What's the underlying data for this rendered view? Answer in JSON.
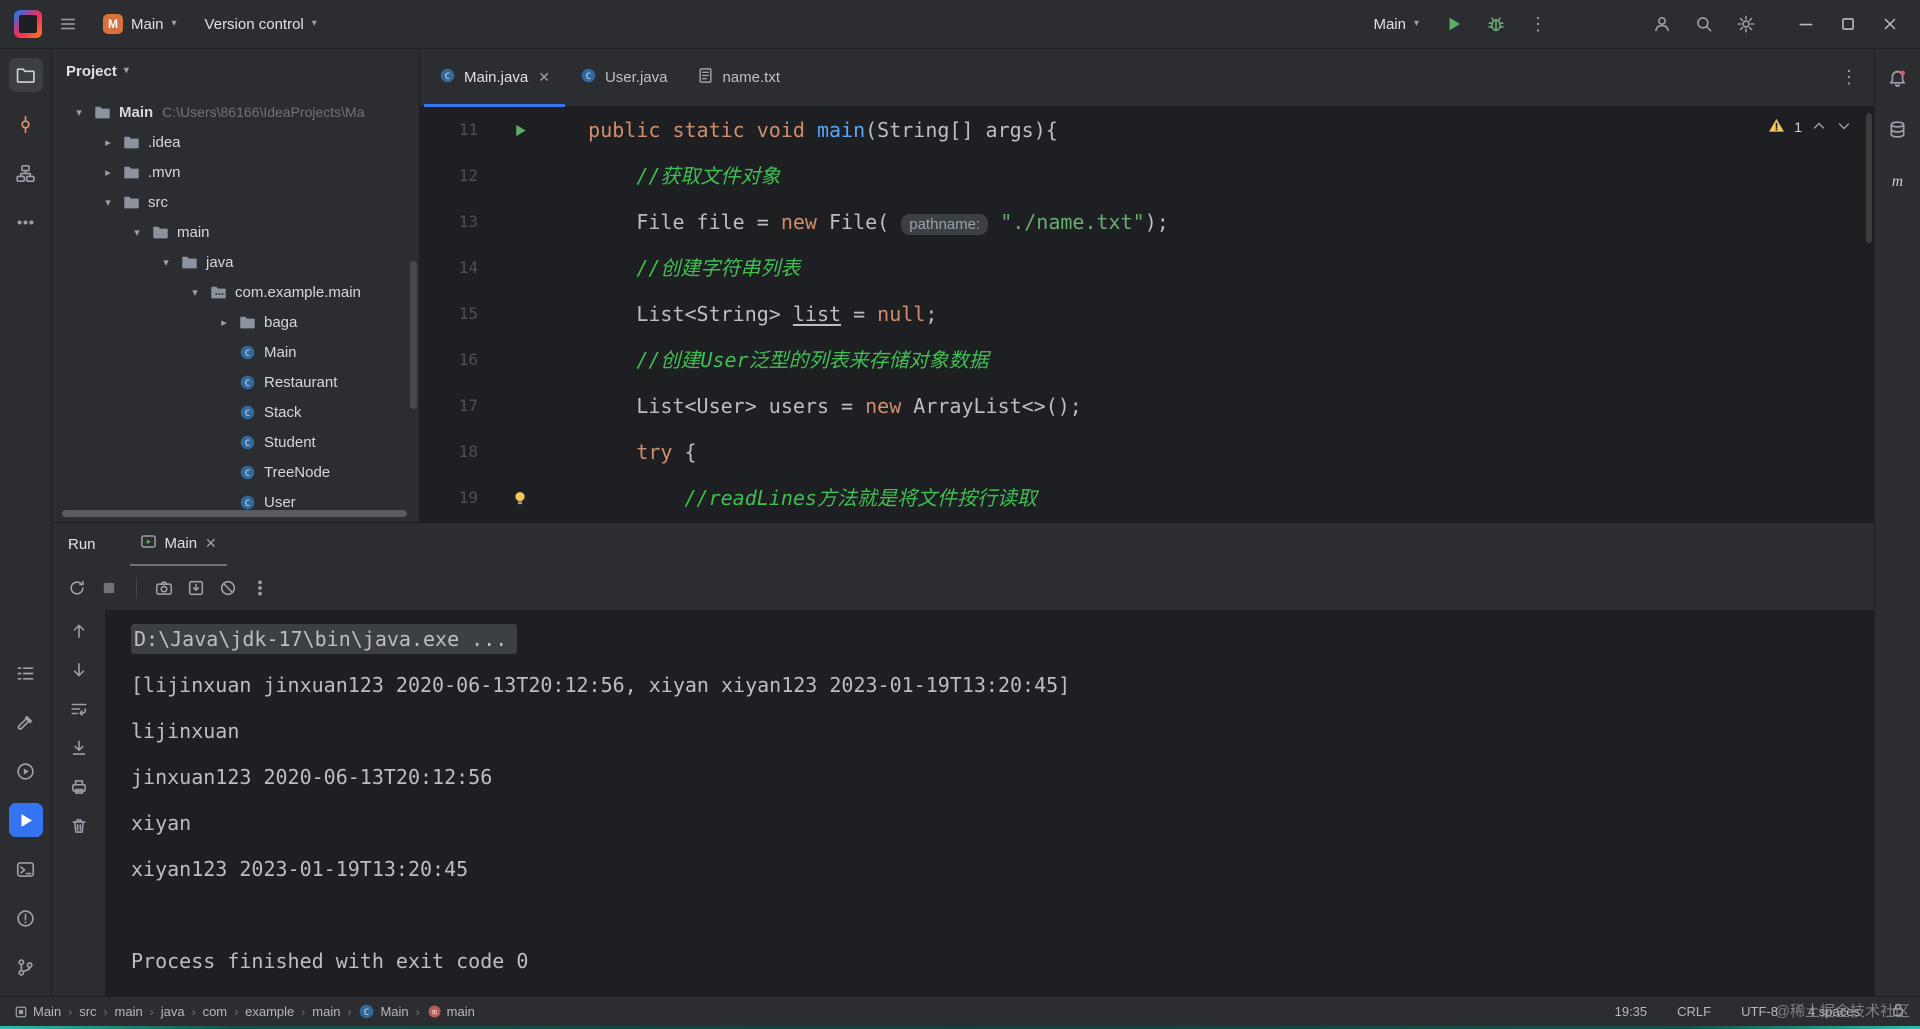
{
  "colors": {
    "accent": "#3574f0",
    "run_green": "#5fad65",
    "keyword": "#cf8e6d",
    "string": "#6aab73",
    "comment": "#3fbf52",
    "method": "#56a8f5",
    "warning": "#f2c55c",
    "editor_bg": "#1e1f22",
    "panel_bg": "#2b2d30"
  },
  "titlebar": {
    "project_initial": "M",
    "project_name": "Main",
    "vcs_label": "Version control",
    "run_config": "Main"
  },
  "left_strip": {
    "top": [
      {
        "name": "project-folder-icon",
        "active": true
      },
      {
        "name": "commit-icon",
        "active": false
      },
      {
        "name": "structure-icon",
        "active": false
      },
      {
        "name": "more-tools-icon",
        "active": false
      }
    ],
    "bottom": [
      {
        "name": "todo-icon",
        "active": false
      },
      {
        "name": "build-icon",
        "active": false
      },
      {
        "name": "services-icon",
        "active": false
      },
      {
        "name": "run-tool-icon",
        "active": true
      },
      {
        "name": "terminal-icon",
        "active": false
      },
      {
        "name": "problems-icon",
        "active": false
      },
      {
        "name": "git-branch-icon",
        "active": false
      }
    ]
  },
  "right_strip": [
    "notifications-icon",
    "database-icon",
    "maven-icon"
  ],
  "project_panel": {
    "title": "Project",
    "tree": [
      {
        "label": "Main",
        "path": "C:\\Users\\86166\\IdeaProjects\\Ma",
        "level": 0,
        "chevron": "expanded",
        "icon": "folder",
        "bold": true
      },
      {
        "label": ".idea",
        "level": 1,
        "chevron": "collapsed",
        "icon": "folder"
      },
      {
        "label": ".mvn",
        "level": 1,
        "chevron": "collapsed",
        "icon": "folder"
      },
      {
        "label": "src",
        "level": 1,
        "chevron": "expanded",
        "icon": "folder"
      },
      {
        "label": "main",
        "level": 2,
        "chevron": "expanded",
        "icon": "folder"
      },
      {
        "label": "java",
        "level": 3,
        "chevron": "expanded",
        "icon": "folder"
      },
      {
        "label": "com.example.main",
        "level": 4,
        "chevron": "expanded",
        "icon": "package"
      },
      {
        "label": "baga",
        "level": 5,
        "chevron": "collapsed",
        "icon": "folder"
      },
      {
        "label": "Main",
        "level": 5,
        "chevron": "none",
        "icon": "class"
      },
      {
        "label": "Restaurant",
        "level": 5,
        "chevron": "none",
        "icon": "class"
      },
      {
        "label": "Stack",
        "level": 5,
        "chevron": "none",
        "icon": "class"
      },
      {
        "label": "Student",
        "level": 5,
        "chevron": "none",
        "icon": "class"
      },
      {
        "label": "TreeNode",
        "level": 5,
        "chevron": "none",
        "icon": "class"
      },
      {
        "label": "User",
        "level": 5,
        "chevron": "none",
        "icon": "class"
      }
    ]
  },
  "editor": {
    "tabs": [
      {
        "label": "Main.java",
        "icon": "class",
        "active": true,
        "closable": true
      },
      {
        "label": "User.java",
        "icon": "class",
        "active": false,
        "closable": false
      },
      {
        "label": "name.txt",
        "icon": "textfile",
        "active": false,
        "closable": false
      }
    ],
    "inspections": {
      "warnings": "1"
    },
    "lines": [
      {
        "num": "11",
        "gutter": "run",
        "tokens": [
          {
            "t": "    "
          },
          {
            "t": "public static void ",
            "s": "kw"
          },
          {
            "t": "main",
            "s": "method"
          },
          {
            "t": "(String[] args){"
          }
        ]
      },
      {
        "num": "12",
        "tokens": [
          {
            "t": "        "
          },
          {
            "t": "//获取文件对象",
            "s": "comment"
          }
        ]
      },
      {
        "num": "13",
        "tokens": [
          {
            "t": "        "
          },
          {
            "t": "File file = "
          },
          {
            "t": "new",
            "s": "kw"
          },
          {
            "t": " File( "
          },
          {
            "t": "pathname:",
            "s": "hint"
          },
          {
            "t": " "
          },
          {
            "t": "\"./name.txt\"",
            "s": "str"
          },
          {
            "t": ");"
          }
        ]
      },
      {
        "num": "14",
        "tokens": [
          {
            "t": "        "
          },
          {
            "t": "//创建字符串列表",
            "s": "comment"
          }
        ]
      },
      {
        "num": "15",
        "tokens": [
          {
            "t": "        "
          },
          {
            "t": "List<String> "
          },
          {
            "t": "list",
            "s": "var"
          },
          {
            "t": " = "
          },
          {
            "t": "null",
            "s": "kw"
          },
          {
            "t": ";"
          }
        ]
      },
      {
        "num": "16",
        "tokens": [
          {
            "t": "        "
          },
          {
            "t": "//创建User泛型的列表来存储对象数据",
            "s": "comment"
          }
        ]
      },
      {
        "num": "17",
        "tokens": [
          {
            "t": "        "
          },
          {
            "t": "List<User> users = "
          },
          {
            "t": "new",
            "s": "kw"
          },
          {
            "t": " ArrayList<>();"
          }
        ]
      },
      {
        "num": "18",
        "tokens": [
          {
            "t": "        "
          },
          {
            "t": "try",
            "s": "kw"
          },
          {
            "t": " {"
          }
        ]
      },
      {
        "num": "19",
        "gutter": "bulb",
        "tokens": [
          {
            "t": "            "
          },
          {
            "t": "//readLines方法就是将文件按行读取",
            "s": "comment"
          }
        ]
      }
    ]
  },
  "run_panel": {
    "title": "Run",
    "tab": "Main",
    "toolbar": [
      "rerun-icon",
      "stop-icon",
      "separator",
      "camera-icon",
      "import-icon",
      "mute-icon",
      "more-options-icon"
    ],
    "gutter_icons": [
      "arrow-up-icon",
      "arrow-down-icon",
      "softwrap-icon",
      "scroll-end-icon",
      "print-icon",
      "clear-icon"
    ],
    "console": [
      {
        "text": "D:\\Java\\jdk-17\\bin\\java.exe ...",
        "style": "folded"
      },
      {
        "text": "[lijinxuan jinxuan123 2020-06-13T20:12:56, xiyan xiyan123 2023-01-19T13:20:45]"
      },
      {
        "text": "lijinxuan"
      },
      {
        "text": "jinxuan123 2020-06-13T20:12:56"
      },
      {
        "text": "xiyan"
      },
      {
        "text": "xiyan123 2023-01-19T13:20:45"
      },
      {
        "text": ""
      },
      {
        "text": "Process finished with exit code 0"
      }
    ]
  },
  "statusbar": {
    "breadcrumbs": [
      {
        "label": "Main",
        "icon": "module"
      },
      {
        "label": "src"
      },
      {
        "label": "main"
      },
      {
        "label": "java"
      },
      {
        "label": "com"
      },
      {
        "label": "example"
      },
      {
        "label": "main"
      },
      {
        "label": "Main",
        "icon": "class"
      },
      {
        "label": "main",
        "icon": "method"
      }
    ],
    "caret": "19:35",
    "line_ending": "CRLF",
    "encoding": "UTF-8",
    "indent": "4 spaces"
  },
  "watermark": "@稀土掘金技术社区"
}
